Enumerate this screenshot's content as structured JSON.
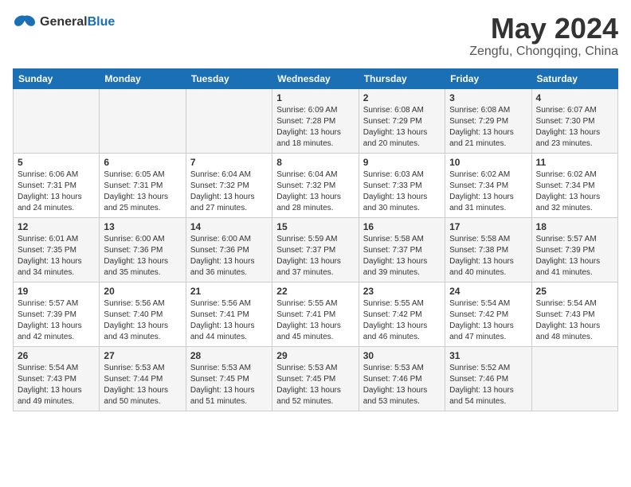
{
  "header": {
    "logo_general": "General",
    "logo_blue": "Blue",
    "month_title": "May 2024",
    "subtitle": "Zengfu, Chongqing, China"
  },
  "days_of_week": [
    "Sunday",
    "Monday",
    "Tuesday",
    "Wednesday",
    "Thursday",
    "Friday",
    "Saturday"
  ],
  "weeks": [
    [
      {
        "day": "",
        "info": ""
      },
      {
        "day": "",
        "info": ""
      },
      {
        "day": "",
        "info": ""
      },
      {
        "day": "1",
        "info": "Sunrise: 6:09 AM\nSunset: 7:28 PM\nDaylight: 13 hours\nand 18 minutes."
      },
      {
        "day": "2",
        "info": "Sunrise: 6:08 AM\nSunset: 7:29 PM\nDaylight: 13 hours\nand 20 minutes."
      },
      {
        "day": "3",
        "info": "Sunrise: 6:08 AM\nSunset: 7:29 PM\nDaylight: 13 hours\nand 21 minutes."
      },
      {
        "day": "4",
        "info": "Sunrise: 6:07 AM\nSunset: 7:30 PM\nDaylight: 13 hours\nand 23 minutes."
      }
    ],
    [
      {
        "day": "5",
        "info": "Sunrise: 6:06 AM\nSunset: 7:31 PM\nDaylight: 13 hours\nand 24 minutes."
      },
      {
        "day": "6",
        "info": "Sunrise: 6:05 AM\nSunset: 7:31 PM\nDaylight: 13 hours\nand 25 minutes."
      },
      {
        "day": "7",
        "info": "Sunrise: 6:04 AM\nSunset: 7:32 PM\nDaylight: 13 hours\nand 27 minutes."
      },
      {
        "day": "8",
        "info": "Sunrise: 6:04 AM\nSunset: 7:32 PM\nDaylight: 13 hours\nand 28 minutes."
      },
      {
        "day": "9",
        "info": "Sunrise: 6:03 AM\nSunset: 7:33 PM\nDaylight: 13 hours\nand 30 minutes."
      },
      {
        "day": "10",
        "info": "Sunrise: 6:02 AM\nSunset: 7:34 PM\nDaylight: 13 hours\nand 31 minutes."
      },
      {
        "day": "11",
        "info": "Sunrise: 6:02 AM\nSunset: 7:34 PM\nDaylight: 13 hours\nand 32 minutes."
      }
    ],
    [
      {
        "day": "12",
        "info": "Sunrise: 6:01 AM\nSunset: 7:35 PM\nDaylight: 13 hours\nand 34 minutes."
      },
      {
        "day": "13",
        "info": "Sunrise: 6:00 AM\nSunset: 7:36 PM\nDaylight: 13 hours\nand 35 minutes."
      },
      {
        "day": "14",
        "info": "Sunrise: 6:00 AM\nSunset: 7:36 PM\nDaylight: 13 hours\nand 36 minutes."
      },
      {
        "day": "15",
        "info": "Sunrise: 5:59 AM\nSunset: 7:37 PM\nDaylight: 13 hours\nand 37 minutes."
      },
      {
        "day": "16",
        "info": "Sunrise: 5:58 AM\nSunset: 7:37 PM\nDaylight: 13 hours\nand 39 minutes."
      },
      {
        "day": "17",
        "info": "Sunrise: 5:58 AM\nSunset: 7:38 PM\nDaylight: 13 hours\nand 40 minutes."
      },
      {
        "day": "18",
        "info": "Sunrise: 5:57 AM\nSunset: 7:39 PM\nDaylight: 13 hours\nand 41 minutes."
      }
    ],
    [
      {
        "day": "19",
        "info": "Sunrise: 5:57 AM\nSunset: 7:39 PM\nDaylight: 13 hours\nand 42 minutes."
      },
      {
        "day": "20",
        "info": "Sunrise: 5:56 AM\nSunset: 7:40 PM\nDaylight: 13 hours\nand 43 minutes."
      },
      {
        "day": "21",
        "info": "Sunrise: 5:56 AM\nSunset: 7:41 PM\nDaylight: 13 hours\nand 44 minutes."
      },
      {
        "day": "22",
        "info": "Sunrise: 5:55 AM\nSunset: 7:41 PM\nDaylight: 13 hours\nand 45 minutes."
      },
      {
        "day": "23",
        "info": "Sunrise: 5:55 AM\nSunset: 7:42 PM\nDaylight: 13 hours\nand 46 minutes."
      },
      {
        "day": "24",
        "info": "Sunrise: 5:54 AM\nSunset: 7:42 PM\nDaylight: 13 hours\nand 47 minutes."
      },
      {
        "day": "25",
        "info": "Sunrise: 5:54 AM\nSunset: 7:43 PM\nDaylight: 13 hours\nand 48 minutes."
      }
    ],
    [
      {
        "day": "26",
        "info": "Sunrise: 5:54 AM\nSunset: 7:43 PM\nDaylight: 13 hours\nand 49 minutes."
      },
      {
        "day": "27",
        "info": "Sunrise: 5:53 AM\nSunset: 7:44 PM\nDaylight: 13 hours\nand 50 minutes."
      },
      {
        "day": "28",
        "info": "Sunrise: 5:53 AM\nSunset: 7:45 PM\nDaylight: 13 hours\nand 51 minutes."
      },
      {
        "day": "29",
        "info": "Sunrise: 5:53 AM\nSunset: 7:45 PM\nDaylight: 13 hours\nand 52 minutes."
      },
      {
        "day": "30",
        "info": "Sunrise: 5:53 AM\nSunset: 7:46 PM\nDaylight: 13 hours\nand 53 minutes."
      },
      {
        "day": "31",
        "info": "Sunrise: 5:52 AM\nSunset: 7:46 PM\nDaylight: 13 hours\nand 54 minutes."
      },
      {
        "day": "",
        "info": ""
      }
    ]
  ]
}
